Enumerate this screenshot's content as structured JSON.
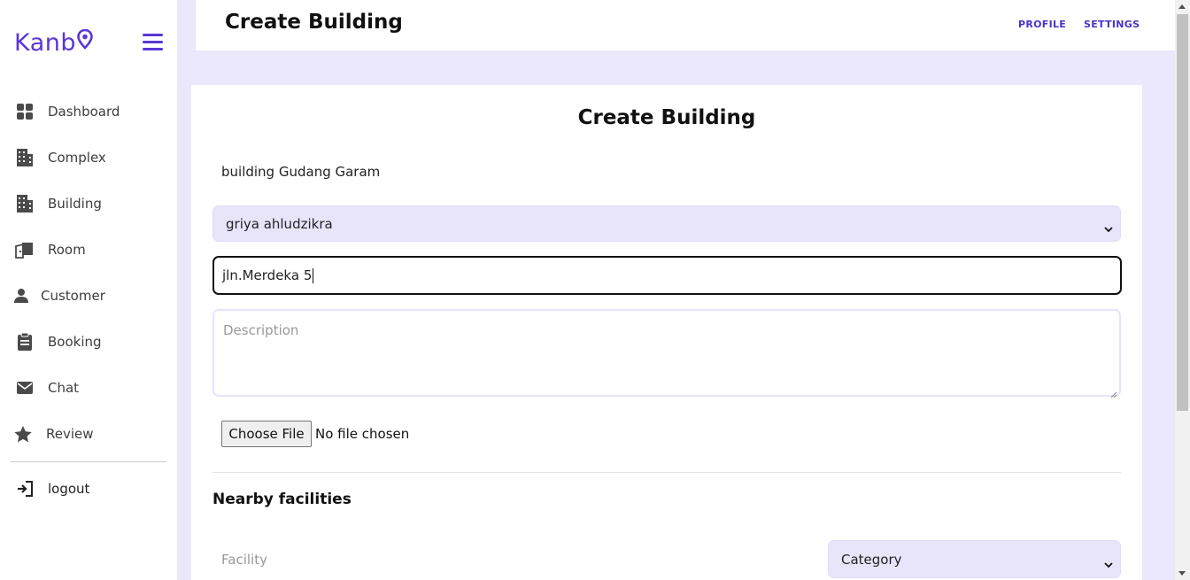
{
  "sidebar": {
    "logo_text": "Kanb",
    "items": [
      {
        "label": "Dashboard",
        "icon": "grid-icon"
      },
      {
        "label": "Complex",
        "icon": "building-icon"
      },
      {
        "label": "Building",
        "icon": "building-icon"
      },
      {
        "label": "Room",
        "icon": "door-icon"
      },
      {
        "label": "Customer",
        "icon": "user-icon"
      },
      {
        "label": "Booking",
        "icon": "clipboard-icon"
      },
      {
        "label": "Chat",
        "icon": "envelope-icon"
      },
      {
        "label": "Review",
        "icon": "star-icon"
      }
    ],
    "logout_label": "logout"
  },
  "header": {
    "title": "Create Building",
    "profile_link": "PROFILE",
    "settings_link": "SETTINGS"
  },
  "form": {
    "title": "Create Building",
    "name_value": "building Gudang Garam",
    "complex_selected": "griya ahludzikra",
    "address_value": "jln.Merdeka 5",
    "description_placeholder": "Description",
    "file_button": "Choose File",
    "file_status": "No file chosen",
    "nearby_title": "Nearby facilities",
    "facility_placeholder": "Facility",
    "category_selected": "Category"
  },
  "colors": {
    "accent": "#5a36d6",
    "link": "#4b33c7",
    "background": "#ebe8fc",
    "select_bg": "#e8e5fb"
  }
}
